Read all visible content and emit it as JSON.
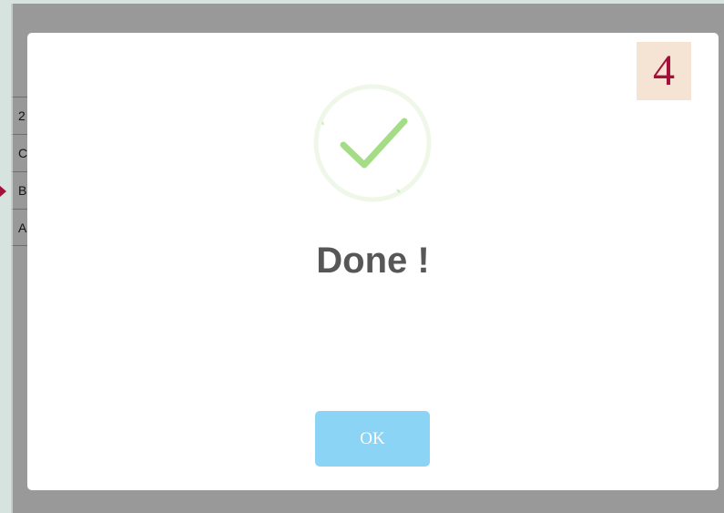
{
  "background_table": {
    "rows": [
      "2",
      "C",
      "B",
      "A"
    ]
  },
  "dialog": {
    "icon": "success-checkmark-icon",
    "title": "Done !",
    "ok_label": "OK"
  },
  "step_badge": "4",
  "colors": {
    "overlay": "#999999",
    "checkmark": "#a5dc86",
    "ring": "#f1f8ec",
    "ok_button": "#8cd4f5",
    "badge_bg": "#f5e3d3",
    "badge_text": "#a5103a",
    "marker": "#a5103a"
  }
}
